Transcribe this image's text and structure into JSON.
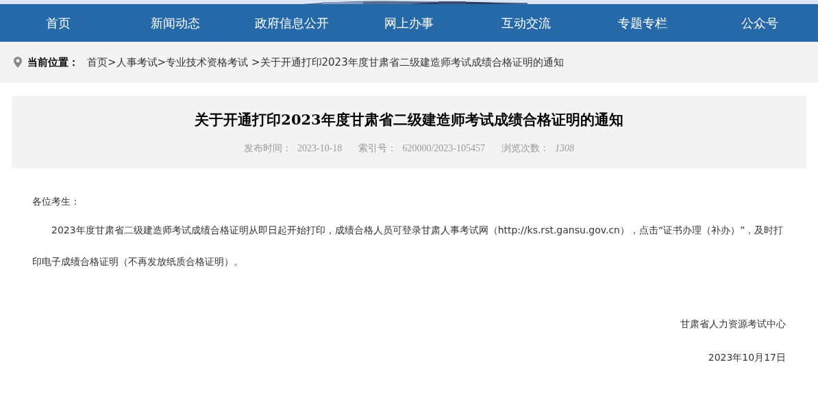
{
  "nav": [
    {
      "label": "首页"
    },
    {
      "label": "新闻动态"
    },
    {
      "label": "政府信息公开"
    },
    {
      "label": "网上办事"
    },
    {
      "label": "互动交流"
    },
    {
      "label": "专题专栏"
    },
    {
      "label": "公众号"
    }
  ],
  "breadcrumb": {
    "label": "当前位置：",
    "items": [
      {
        "kind": "link",
        "text": "首页"
      },
      {
        "kind": "separator",
        "text": ">"
      },
      {
        "kind": "link",
        "text": "人事考试"
      },
      {
        "kind": "separator",
        "text": ">"
      },
      {
        "kind": "link",
        "text": "专业技术资格考试"
      },
      {
        "kind": "separator",
        "text": " >"
      },
      {
        "kind": "link",
        "text": "关于开通打印2023年度甘肃省二级建造师考试成绩合格证明的通知"
      }
    ]
  },
  "article": {
    "title": "关于开通打印2023年度甘肃省二级建造师考试成绩合格证明的通知",
    "meta": [
      {
        "label": "发布时间：",
        "value": "2023-10-18",
        "italic": false
      },
      {
        "label": "索引号：",
        "value": "620000/2023-105457",
        "italic": false
      },
      {
        "label": "浏览次数：",
        "value": "1308",
        "italic": true
      }
    ],
    "salutation": "各位考生：",
    "paragraph": "2023年度甘肃省二级建造师考试成绩合格证明从即日起开始打印，成绩合格人员可登录甘肃人事考试网（http://ks.rst.gansu.gov.cn），点击“证书办理（补办）”，及时打印电子成绩合格证明（不再发放纸质合格证明）。",
    "signature": "甘肃省人力资源考试中心",
    "date": "2023年10月17日"
  }
}
